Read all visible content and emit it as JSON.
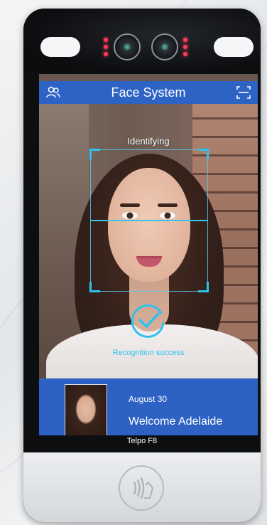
{
  "app": {
    "title": "Face System",
    "status": "Identifying",
    "result": "Recognition success"
  },
  "visitor": {
    "date": "August 30",
    "greeting": "Welcome Adelaide"
  },
  "device": {
    "brand": "Telpo F8"
  },
  "icons": {
    "left_header": "users-icon",
    "right_header": "face-scan-icon",
    "success": "check-circle-icon",
    "nfc": "nfc-contactless-icon"
  },
  "colors": {
    "header": "#2e63c6",
    "accent": "#2ec2ef",
    "led": "#ff3b5c"
  }
}
